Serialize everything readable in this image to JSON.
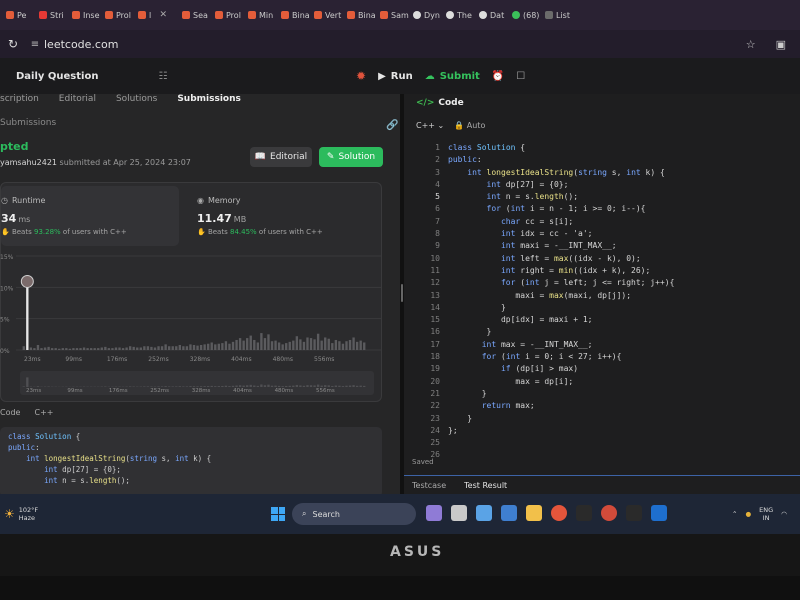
{
  "browser": {
    "tabs": [
      {
        "label": "Pe",
        "icon": "leetcode"
      },
      {
        "label": "Stri",
        "icon": "youtube"
      },
      {
        "label": "Inse",
        "icon": "leetcode"
      },
      {
        "label": "Prol",
        "icon": "leetcode"
      },
      {
        "label": "l",
        "icon": "leetcode"
      },
      {
        "label": "Sea",
        "icon": "leetcode"
      },
      {
        "label": "Prol",
        "icon": "leetcode"
      },
      {
        "label": "Min",
        "icon": "leetcode"
      },
      {
        "label": "Bina",
        "icon": "leetcode"
      },
      {
        "label": "Vert",
        "icon": "leetcode"
      },
      {
        "label": "Bina",
        "icon": "leetcode"
      },
      {
        "label": "Sam",
        "icon": "leetcode"
      },
      {
        "label": "Dyn",
        "icon": "github"
      },
      {
        "label": "The",
        "icon": "github"
      },
      {
        "label": "Dat",
        "icon": "github"
      },
      {
        "label": "(68)",
        "icon": "whatsapp"
      },
      {
        "label": "List",
        "icon": "generic"
      }
    ],
    "url": "leetcode.com"
  },
  "header": {
    "title": "Daily Question",
    "run_label": "Run",
    "submit_label": "Submit"
  },
  "left": {
    "tabs": [
      "scription",
      "Editorial",
      "Solutions",
      "Submissions"
    ],
    "submissions_link": "Submissions",
    "status": "pted",
    "author_name": "yamsahu2421",
    "submitted_text": "submitted at Apr 25, 2024 23:07",
    "editorial_button": "Editorial",
    "solution_button": "Solution",
    "runtime": {
      "title": "Runtime",
      "value": "34",
      "unit": "ms",
      "beats_prefix": "Beats",
      "beats_pct": "93.28%",
      "beats_suffix": "of users with C++"
    },
    "memory": {
      "title": "Memory",
      "value": "11.47",
      "unit": "MB",
      "beats_prefix": "Beats",
      "beats_pct": "84.45%",
      "beats_suffix": "of users with C++"
    },
    "code_label": "Code",
    "code_lang": "C++"
  },
  "chart_data": {
    "type": "bar",
    "title": "",
    "xlabel": "",
    "ylabel": "",
    "y_ticks": [
      "15%",
      "10%",
      "5%",
      "0%"
    ],
    "ylim": [
      0,
      15
    ],
    "x_ticks": [
      "23ms",
      "99ms",
      "176ms",
      "252ms",
      "328ms",
      "404ms",
      "480ms",
      "556ms"
    ],
    "mini_ticks": [
      "23ms",
      "99ms",
      "176ms",
      "252ms",
      "328ms",
      "404ms",
      "480ms",
      "556ms"
    ],
    "highlight_category": "34ms",
    "values": [
      0.6,
      10.3,
      0.4,
      0.3,
      0.8,
      0.3,
      0.4,
      0.5,
      0.3,
      0.3,
      0.2,
      0.3,
      0.3,
      0.2,
      0.3,
      0.3,
      0.3,
      0.4,
      0.3,
      0.3,
      0.3,
      0.3,
      0.4,
      0.5,
      0.3,
      0.3,
      0.4,
      0.4,
      0.3,
      0.4,
      0.6,
      0.5,
      0.4,
      0.4,
      0.6,
      0.6,
      0.5,
      0.4,
      0.6,
      0.6,
      0.9,
      0.6,
      0.6,
      0.6,
      0.8,
      0.6,
      0.6,
      0.9,
      0.8,
      0.7,
      0.8,
      0.9,
      1.0,
      1.2,
      0.9,
      1.0,
      1.1,
      1.4,
      1.0,
      1.3,
      1.6,
      1.9,
      1.5,
      1.9,
      2.3,
      1.6,
      1.2,
      2.7,
      1.9,
      2.5,
      1.4,
      1.5,
      1.2,
      0.9,
      1.1,
      1.3,
      1.5,
      2.2,
      1.7,
      1.3,
      2.0,
      1.9,
      1.7,
      2.6,
      1.5,
      2.0,
      1.8,
      1.1,
      1.6,
      1.4,
      1.0,
      1.4,
      1.6,
      2.0,
      1.3,
      1.5,
      1.2
    ]
  },
  "preview_code": [
    "class Solution {",
    "public:",
    "    int longestIdealString(string s, int k) {",
    "        int dp[27] = {0};",
    "        int n = s.length();"
  ],
  "editor": {
    "tab": "Code",
    "lang": "C++",
    "mode": "Auto",
    "saved": "Saved",
    "current_line": 5,
    "lines": [
      "class Solution {",
      "public:",
      "    int longestIdealString(string s, int k) {",
      "        int dp[27] = {0};",
      "        int n = s.length();",
      "        for (int i = n - 1; i >= 0; i--){",
      "           char cc = s[i];",
      "           int idx = cc - 'a';",
      "           int maxi = -__INT_MAX__;",
      "",
      "           int left = max((idx - k), 0);",
      "           int right = min((idx + k), 26);",
      "",
      "           for (int j = left; j <= right; j++){",
      "              maxi = max(maxi, dp[j]);",
      "           }",
      "           dp[idx] = maxi + 1;",
      "        }",
      "       int max = -__INT_MAX__;",
      "       for (int i = 0; i < 27; i++){",
      "           if (dp[i] > max)",
      "              max = dp[i];",
      "       }",
      "       return max;",
      "    }",
      "};"
    ],
    "bottom_tabs": [
      "Testcase",
      "Test Result"
    ]
  },
  "taskbar": {
    "temp": "102°F",
    "weather": "Haze",
    "search_placeholder": "Search",
    "lang_line1": "ENG",
    "lang_line2": "IN"
  },
  "bezel": {
    "brand": "ASUS"
  }
}
